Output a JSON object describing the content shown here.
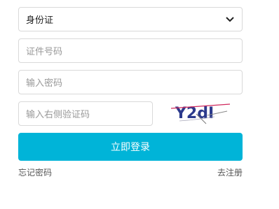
{
  "form": {
    "id_type": {
      "selected": "身份证"
    },
    "id_number": {
      "placeholder": "证件号码"
    },
    "password": {
      "placeholder": "输入密码"
    },
    "captcha": {
      "placeholder": "输入右侧验证码",
      "image_text": "Y2dI"
    },
    "login_label": "立即登录",
    "forgot_label": "忘记密码",
    "register_label": "去注册"
  },
  "colors": {
    "primary": "#00b4d8",
    "border": "#d9d9d9",
    "placeholder": "#999999",
    "captcha_text": "#2c3a8c",
    "captcha_noise": "#d0285c"
  }
}
